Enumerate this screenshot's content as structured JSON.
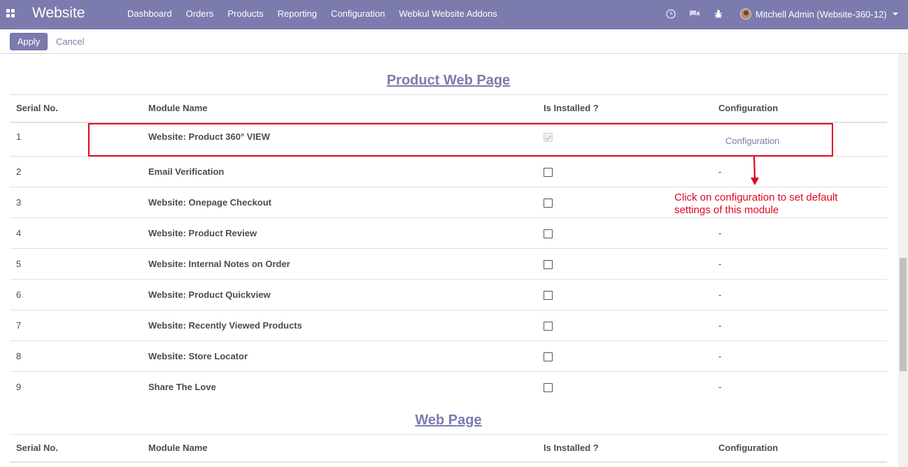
{
  "navbar": {
    "brand": "Website",
    "menu": [
      "Dashboard",
      "Orders",
      "Products",
      "Reporting",
      "Configuration",
      "Webkul Website Addons"
    ],
    "user": "Mitchell Admin (Website-360-12)"
  },
  "control": {
    "apply_label": "Apply",
    "cancel_label": "Cancel"
  },
  "sections": [
    {
      "title": "Product Web Page",
      "headers": [
        "Serial No.",
        "Module Name",
        "Is Installed ?",
        "Configuration"
      ],
      "rows": [
        {
          "serial": "1",
          "name": "Website: Product 360° VIEW",
          "installed": true,
          "config": "Configuration"
        },
        {
          "serial": "2",
          "name": "Email Verification",
          "installed": false,
          "config": "-"
        },
        {
          "serial": "3",
          "name": "Website: Onepage Checkout",
          "installed": false,
          "config": "-"
        },
        {
          "serial": "4",
          "name": "Website: Product Review",
          "installed": false,
          "config": "-"
        },
        {
          "serial": "5",
          "name": "Website: Internal Notes on Order",
          "installed": false,
          "config": "-"
        },
        {
          "serial": "6",
          "name": "Website: Product Quickview",
          "installed": false,
          "config": "-"
        },
        {
          "serial": "7",
          "name": "Website: Recently Viewed Products",
          "installed": false,
          "config": "-"
        },
        {
          "serial": "8",
          "name": "Website: Store Locator",
          "installed": false,
          "config": "-"
        },
        {
          "serial": "9",
          "name": "Share The Love",
          "installed": false,
          "config": "-"
        }
      ]
    },
    {
      "title": "Web Page",
      "headers": [
        "Serial No.",
        "Module Name",
        "Is Installed ?",
        "Configuration"
      ]
    }
  ],
  "annotation": {
    "callout_line1": "Click on configuration to set default",
    "callout_line2": "settings of this module",
    "color": "#e0061e"
  },
  "colors": {
    "brand": "#7c7bad"
  }
}
